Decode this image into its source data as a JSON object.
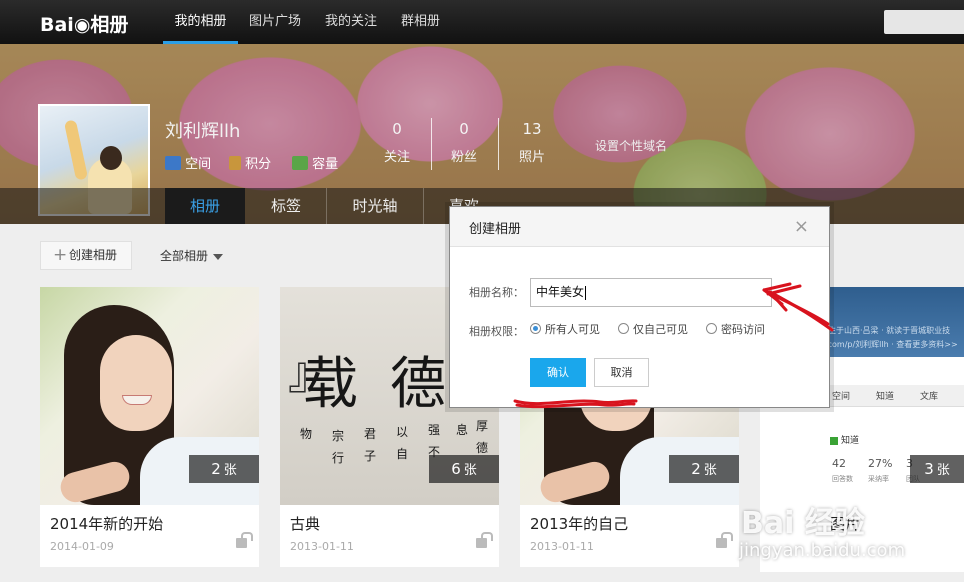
{
  "topnav": {
    "logo_text": "Bai",
    "logo_suffix": "相册",
    "items": [
      "我的相册",
      "图片广场",
      "我的关注",
      "群相册"
    ]
  },
  "profile": {
    "username": "刘利辉llh",
    "links": [
      "空间",
      "积分",
      "容量"
    ],
    "stats": [
      {
        "num": "0",
        "label": "关注"
      },
      {
        "num": "0",
        "label": "粉丝"
      },
      {
        "num": "13",
        "label": "照片"
      }
    ],
    "custom_domain": "设置个性域名"
  },
  "tabs": [
    "相册",
    "标签",
    "时光轴",
    "喜欢"
  ],
  "toolbar": {
    "create_album": "创建相册",
    "all_albums": "全部相册"
  },
  "albums": [
    {
      "title": "2014年新的开始",
      "date": "2014-01-09",
      "count": "2",
      "unit": "张"
    },
    {
      "title": "古典",
      "date": "2013-01-11",
      "count": "6",
      "unit": "张"
    },
    {
      "title": "2013年的自己",
      "date": "2013-01-11",
      "count": "2",
      "unit": "张"
    },
    {
      "title": "图片",
      "date": "",
      "count": "3",
      "unit": "张"
    }
  ],
  "right_card": {
    "line1": "出生于山西·吕梁 · 就读于晋城职业技",
    "line2": "u.com/p/刘利辉llh · 查看更多资料>>",
    "tabs": [
      "空间",
      "知道",
      "文库"
    ],
    "zhidao": "知道",
    "nums": [
      "42",
      "27%",
      "3"
    ],
    "labels": [
      "回答数",
      "采纳率",
      "团队"
    ]
  },
  "calligraphy": {
    "big": [
      "载",
      "德"
    ],
    "small": [
      "物",
      "宗",
      "行",
      "君",
      "子",
      "以",
      "自",
      "强",
      "不",
      "息",
      "厚",
      "德"
    ]
  },
  "dialog": {
    "title": "创建相册",
    "close": "×",
    "name_label": "相册名称：",
    "name_value": "中年美女",
    "perm_label": "相册权限：",
    "options": [
      "所有人可见",
      "仅自己可见",
      "密码访问"
    ],
    "selected": 0,
    "ok": "确认",
    "cancel": "取消"
  },
  "watermark": {
    "brand": "Bai 经验",
    "url": "jingyan.baidu.com"
  },
  "colors": {
    "accent": "#1aa7ec",
    "nav_active": "#2a9ee6",
    "annotation": "#d8131e"
  }
}
